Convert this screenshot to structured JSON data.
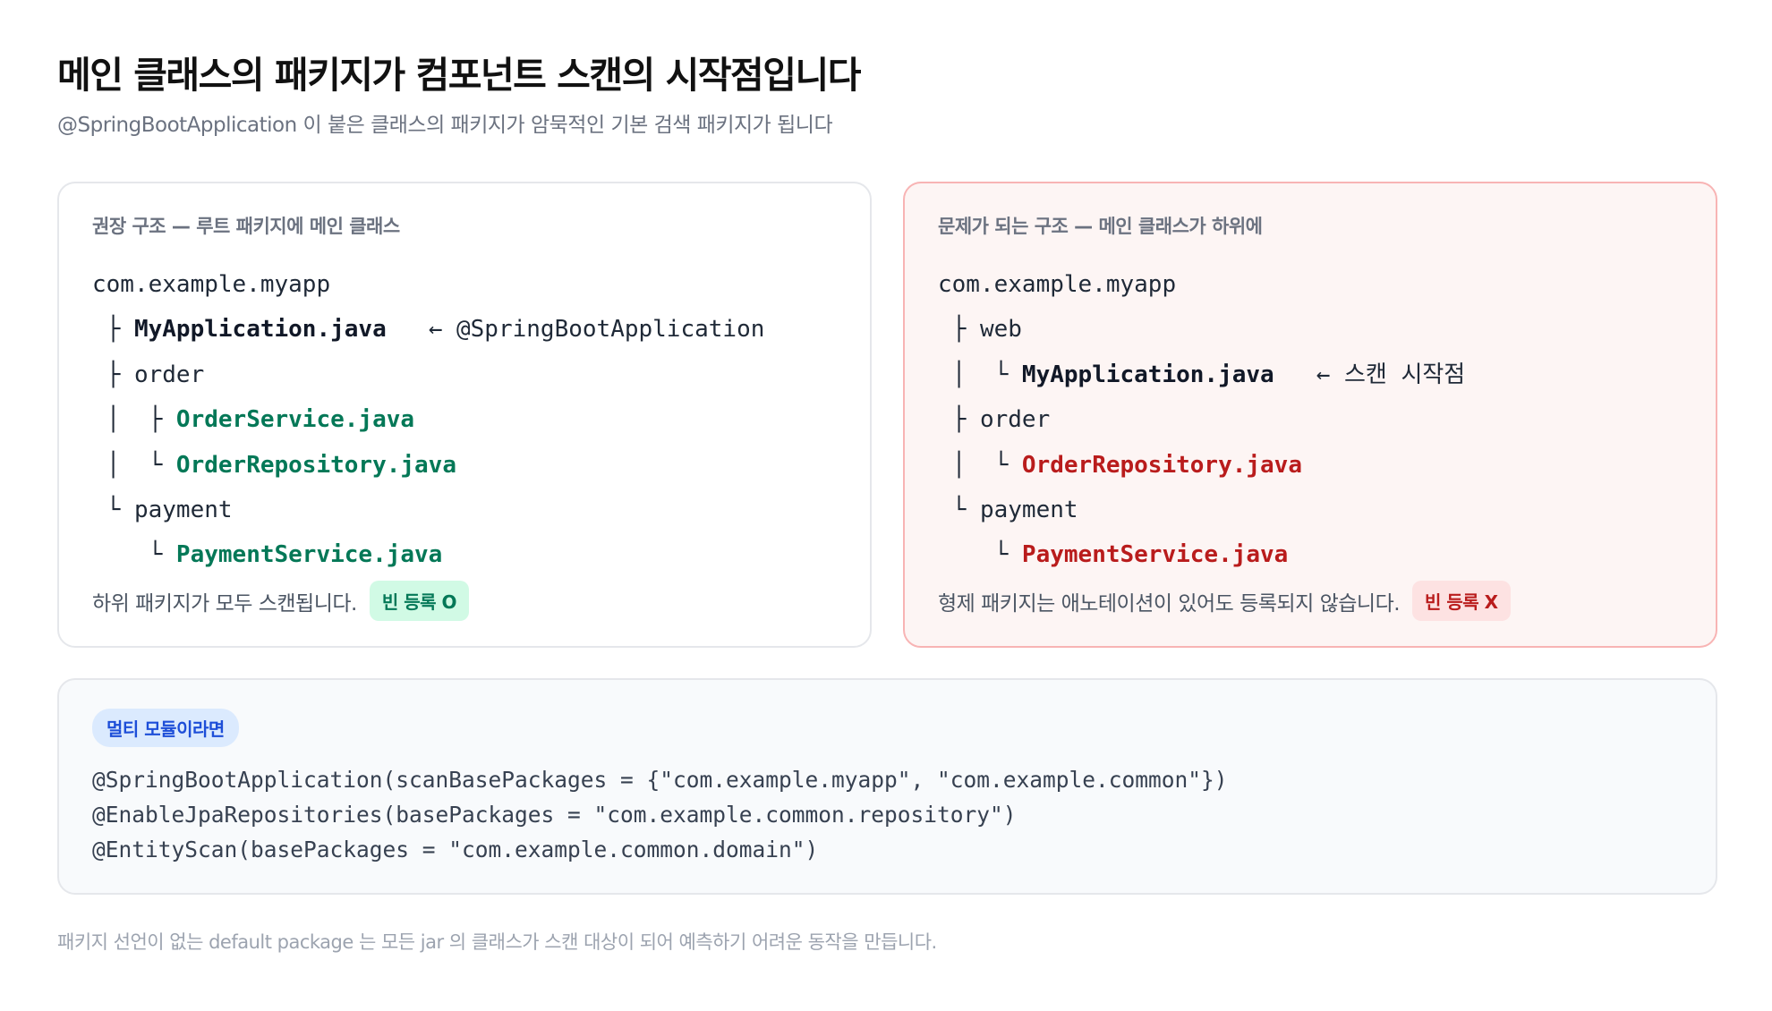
{
  "header": {
    "title": "메인 클래스의 패키지가 컴포넌트 스캔의 시작점입니다",
    "subtitle": "@SpringBootApplication 이 붙은 클래스의 패키지가 암묵적인 기본 검색 패키지가 됩니다"
  },
  "good_card": {
    "title": "권장 구조 — 루트 패키지에 메인 클래스",
    "tree": [
      {
        "prefix": "",
        "name": "com.example.myapp",
        "note": ""
      },
      {
        "prefix": " ├ ",
        "name": "MyApplication.java",
        "note": "   ← @SpringBootApplication"
      },
      {
        "prefix": " ├ ",
        "name": "order",
        "note": ""
      },
      {
        "prefix": " │  ├ ",
        "name": "OrderService.java",
        "note": ""
      },
      {
        "prefix": " │  └ ",
        "name": "OrderRepository.java",
        "note": ""
      },
      {
        "prefix": " └ ",
        "name": "payment",
        "note": ""
      },
      {
        "prefix": "    └ ",
        "name": "PaymentService.java",
        "note": ""
      }
    ],
    "footer_text": "하위 패키지가 모두 스캔됩니다.",
    "badge": "빈 등록 O"
  },
  "bad_card": {
    "title": "문제가 되는 구조 — 메인 클래스가 하위에",
    "tree": [
      {
        "prefix": "",
        "name": "com.example.myapp",
        "note": ""
      },
      {
        "prefix": " ├ ",
        "name": "web",
        "note": ""
      },
      {
        "prefix": " │  └ ",
        "name": "MyApplication.java",
        "note": "   ← 스캔 시작점"
      },
      {
        "prefix": " ├ ",
        "name": "order",
        "note": ""
      },
      {
        "prefix": " │  └ ",
        "name": "OrderRepository.java",
        "note": ""
      },
      {
        "prefix": " └ ",
        "name": "payment",
        "note": ""
      },
      {
        "prefix": "    └ ",
        "name": "PaymentService.java",
        "note": ""
      }
    ],
    "footer_text": "형제 패키지는 애노테이션이 있어도 등록되지 않습니다.",
    "badge": "빈 등록 X"
  },
  "multi_module": {
    "badge": "멀티 모듈이라면",
    "code": [
      "@SpringBootApplication(scanBasePackages = {\"com.example.myapp\", \"com.example.common\"})",
      "@EnableJpaRepositories(basePackages = \"com.example.common.repository\")",
      "@EntityScan(basePackages = \"com.example.common.domain\")"
    ]
  },
  "footnote": "패키지 선언이 없는 default package 는 모든 jar 의 클래스가 스캔 대상이 되어 예측하기 어려운 동작을 만듭니다.",
  "colors": {
    "good_accent": "#047857",
    "bad_accent": "#b91c1c",
    "info_accent": "#1d4ed8"
  }
}
